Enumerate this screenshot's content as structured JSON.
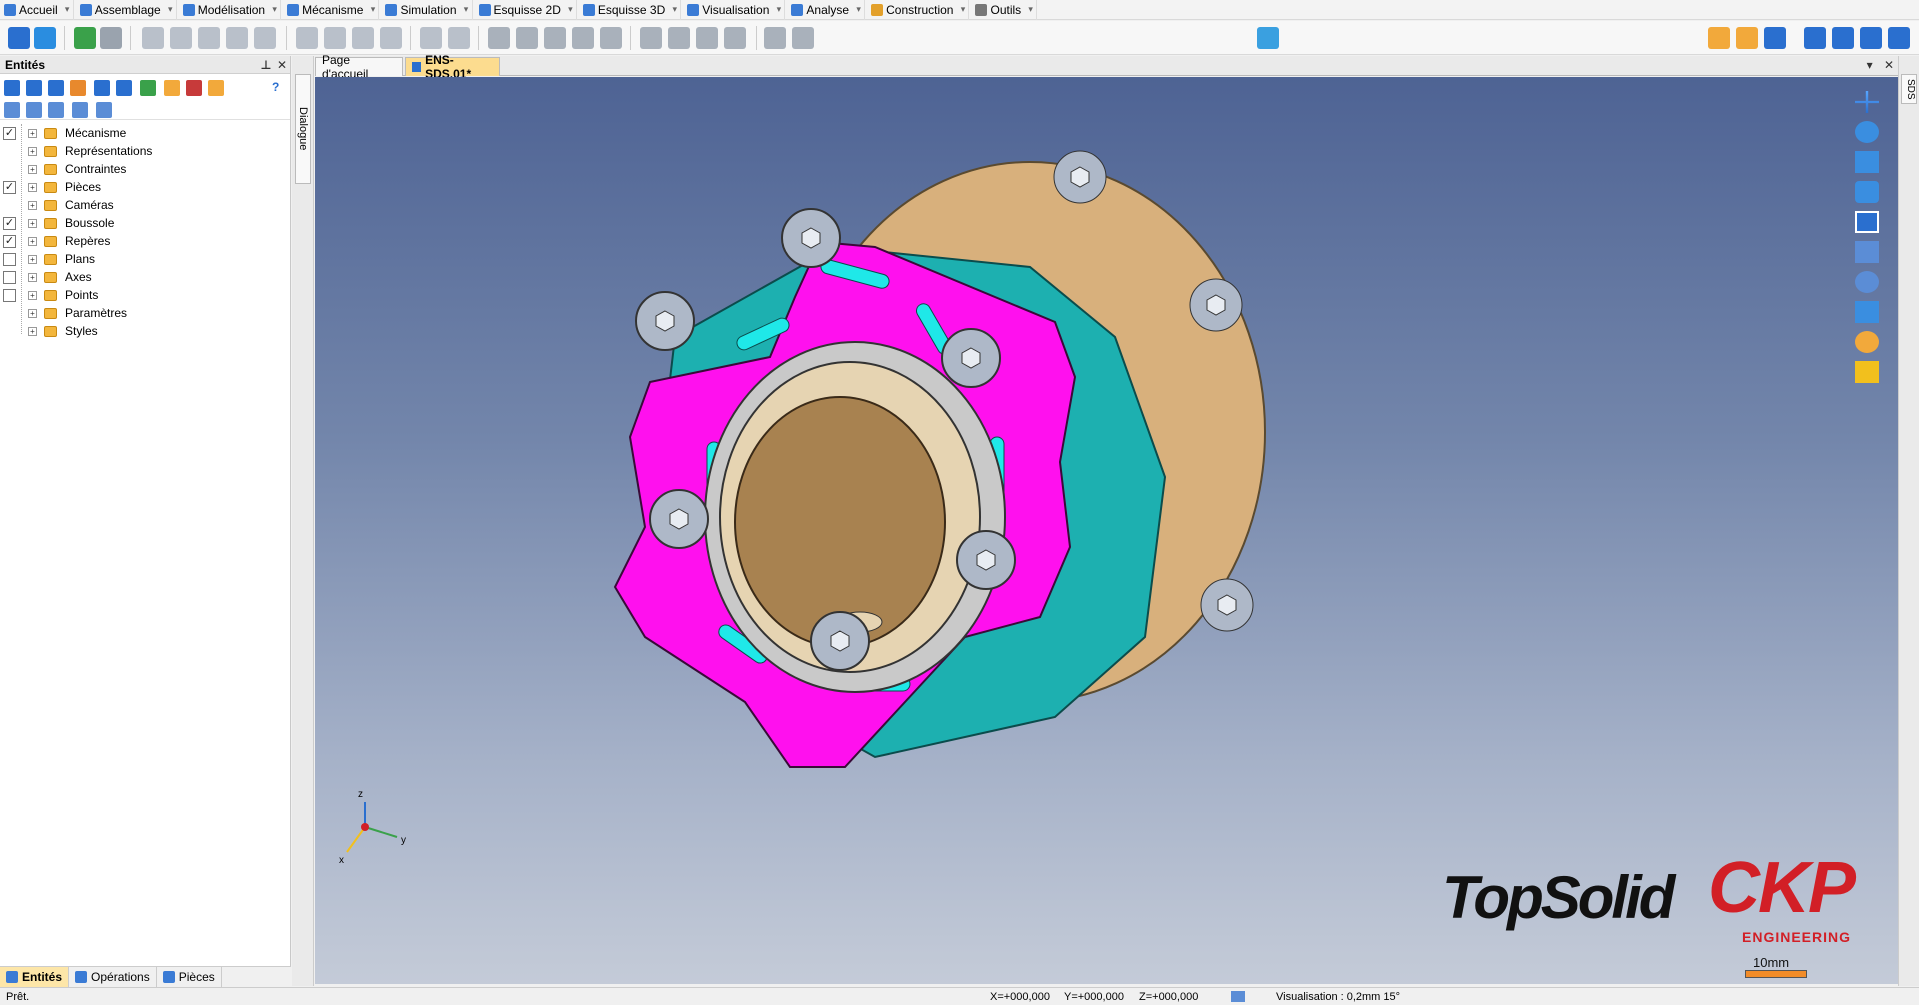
{
  "menu": [
    {
      "label": "Accueil",
      "color": "#3a7bd5"
    },
    {
      "label": "Assemblage",
      "color": "#3a7bd5"
    },
    {
      "label": "Modélisation",
      "color": "#3a7bd5"
    },
    {
      "label": "Mécanisme",
      "color": "#3a7bd5"
    },
    {
      "label": "Simulation",
      "color": "#3a7bd5"
    },
    {
      "label": "Esquisse 2D",
      "color": "#3a7bd5"
    },
    {
      "label": "Esquisse 3D",
      "color": "#3a7bd5"
    },
    {
      "label": "Visualisation",
      "color": "#3a7bd5"
    },
    {
      "label": "Analyse",
      "color": "#3a7bd5"
    },
    {
      "label": "Construction",
      "color": "#e3a02a"
    },
    {
      "label": "Outils",
      "color": "#777777"
    }
  ],
  "panel": {
    "title": "Entités",
    "pin": "📌",
    "close": "✕",
    "help": "?",
    "tree": [
      {
        "label": "Mécanisme",
        "checkbox": true,
        "checked": true
      },
      {
        "label": "Représentations",
        "checkbox": false,
        "checked": false
      },
      {
        "label": "Contraintes",
        "checkbox": false,
        "checked": false
      },
      {
        "label": "Pièces",
        "checkbox": true,
        "checked": true
      },
      {
        "label": "Caméras",
        "checkbox": false,
        "checked": false
      },
      {
        "label": "Boussole",
        "checkbox": true,
        "checked": true
      },
      {
        "label": "Repères",
        "checkbox": true,
        "checked": true
      },
      {
        "label": "Plans",
        "checkbox": true,
        "checked": false
      },
      {
        "label": "Axes",
        "checkbox": true,
        "checked": false
      },
      {
        "label": "Points",
        "checkbox": true,
        "checked": false
      },
      {
        "label": "Paramètres",
        "checkbox": false,
        "checked": false
      },
      {
        "label": "Styles",
        "checkbox": false,
        "checked": false
      }
    ],
    "tabs": [
      {
        "label": "Entités",
        "active": true
      },
      {
        "label": "Opérations",
        "active": false
      },
      {
        "label": "Pièces",
        "active": false
      }
    ]
  },
  "dialog_tab": "Dialogue",
  "sds_tab": "SDS",
  "doc_tabs": [
    {
      "label": "Page d'accueil",
      "active": false
    },
    {
      "label": "ENS-SDS.01*",
      "active": true
    }
  ],
  "viewport": {
    "logo_brand": "TopSolid",
    "logo_ckp": "CKP",
    "logo_engineering": "ENGINEERING",
    "scale_label": "10mm",
    "axis_x": "x",
    "axis_y": "y",
    "axis_z": "z"
  },
  "status": {
    "message": "Prêt.",
    "x": "X=+000,000",
    "y": "Y=+000,000",
    "z": "Z=+000,000",
    "visualisation": "Visualisation : 0,2mm 15°"
  },
  "colors": {
    "accent": "#fcdc8f",
    "magenta": "#ff10ee",
    "teal": "#1db0b0",
    "tan": "#d8b07c",
    "bronze": "#b08a58"
  }
}
